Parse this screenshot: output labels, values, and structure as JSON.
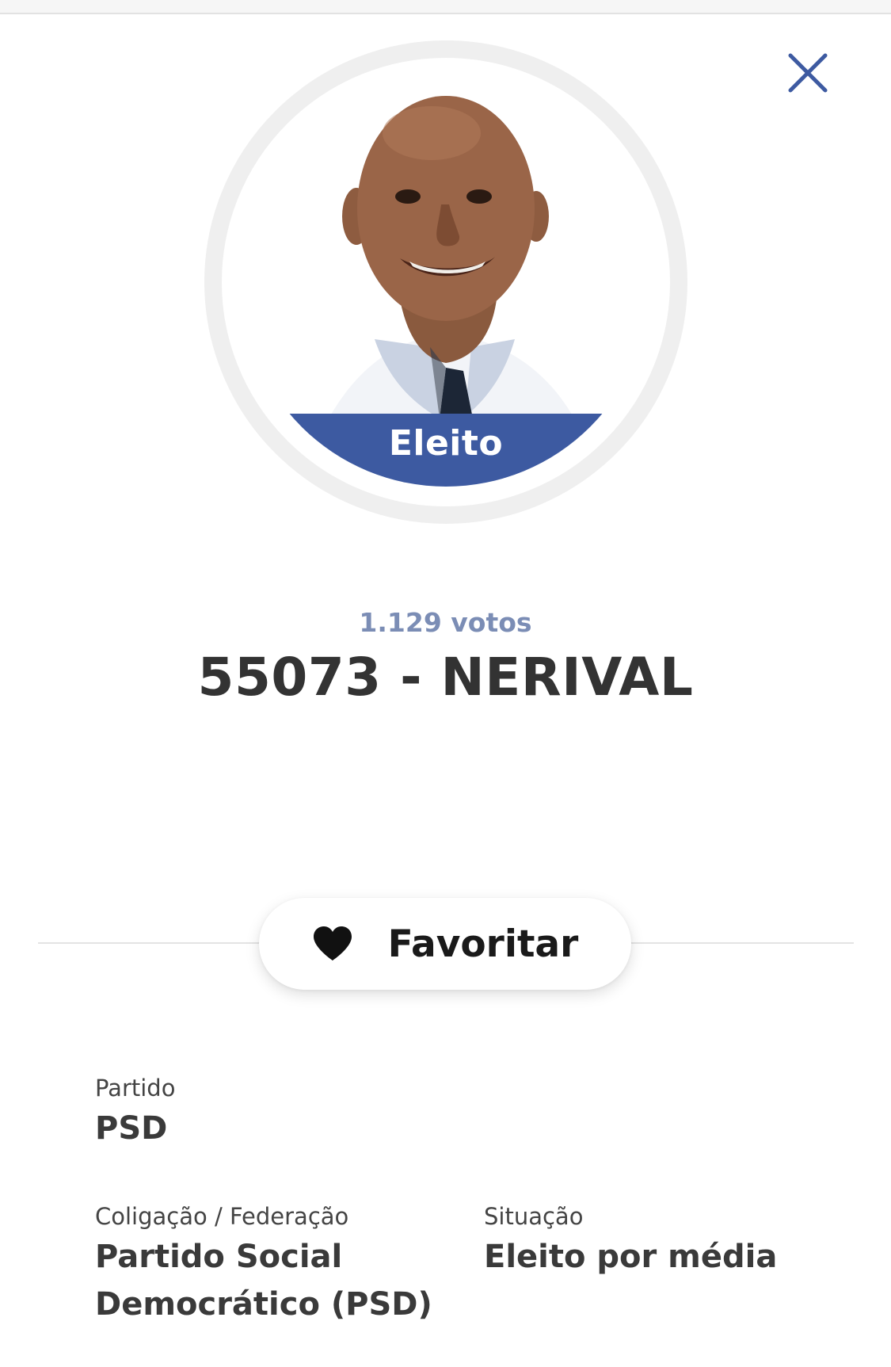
{
  "modal": {
    "status_badge": "Eleito",
    "votes": "1.129 votos",
    "candidate_title": "55073 - NERIVAL",
    "favorite_label": "Favoritar"
  },
  "details": {
    "party": {
      "label": "Partido",
      "value": "PSD"
    },
    "coalition": {
      "label": "Coligação / Federação",
      "value_line1": "Partido Social",
      "value_line2": "Democrático (PSD)"
    },
    "situation": {
      "label": "Situação",
      "value": "Eleito por média"
    }
  },
  "colors": {
    "accent": "#3d5aa1",
    "votes": "#7b8db5",
    "close_icon": "#3d5aa1"
  },
  "icons": {
    "close": "close-icon",
    "favorite": "heart-icon"
  }
}
